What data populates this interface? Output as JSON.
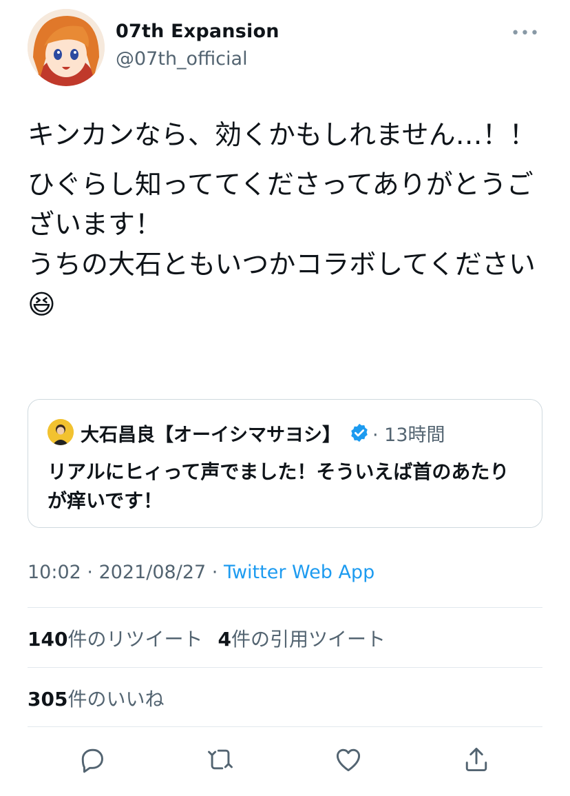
{
  "author": {
    "name": "07th Expansion",
    "handle": "@07th_official"
  },
  "more_label": "•••",
  "tweet": {
    "paragraphs": [
      "キンカンなら、効くかもしれません…！！",
      "ひぐらし知っててくださってありがとうございます！\nうちの大石ともいつかコラボしてください😆"
    ]
  },
  "quote": {
    "name": "大石昌良【オーイシマサヨシ】",
    "time": "· 13時間",
    "text": "リアルにヒィって声でました！そういえば首のあたりが痒いです！"
  },
  "meta": {
    "time": "10:02",
    "sep1": " · ",
    "date": "2021/08/27",
    "sep2": " · ",
    "app": "Twitter Web App"
  },
  "stats": {
    "retweets_count": "140",
    "retweets_label": "件のリツイート",
    "quotes_count": "4",
    "quotes_label": "件の引用ツイート",
    "likes_count": "305",
    "likes_label": "件のいいね"
  },
  "colors": {
    "link": "#1d9bf0",
    "secondary_text": "#536471",
    "verified": "#1d9bf0"
  },
  "icons": [
    "reply-icon",
    "retweet-icon",
    "like-icon",
    "share-icon",
    "verified-badge-icon"
  ]
}
